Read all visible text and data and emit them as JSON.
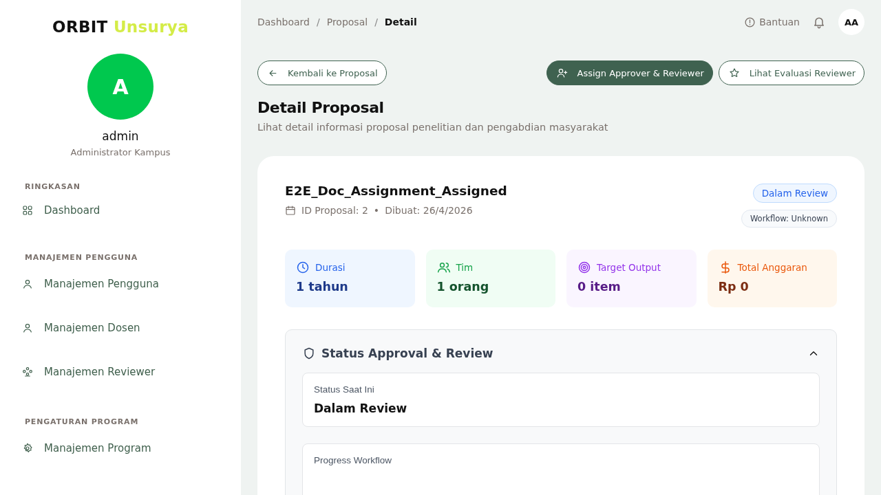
{
  "sidebar": {
    "brand": {
      "name": "ORBIT",
      "accent": "Unsurya"
    },
    "user": {
      "initial": "A",
      "name": "admin",
      "role": "Administrator Kampus"
    },
    "sections": [
      {
        "title": "RINGKASAN",
        "items": [
          {
            "label": "Dashboard",
            "kind": "grid"
          }
        ]
      },
      {
        "title": "MANAJEMEN PENGGUNA",
        "items": [
          {
            "label": "Manajemen Pengguna",
            "kind": "user"
          },
          {
            "label": "Manajemen Dosen",
            "kind": "user"
          },
          {
            "label": "Manajemen Reviewer",
            "kind": "group"
          }
        ]
      },
      {
        "title": "PENGATURAN PROGRAM",
        "items": [
          {
            "label": "Manajemen Program",
            "kind": "gear"
          }
        ]
      }
    ]
  },
  "topbar": {
    "breadcrumbs": [
      {
        "label": "Dashboard",
        "selected": false
      },
      {
        "label": "Proposal",
        "selected": false
      },
      {
        "label": "Detail",
        "selected": true
      }
    ],
    "separator": "/",
    "help": "Bantuan",
    "avatar": "AA"
  },
  "actions": {
    "back": "Kembali ke Proposal",
    "assign": "Assign Approver & Reviewer",
    "evaluation": "Lihat Evaluasi Reviewer"
  },
  "page": {
    "title": "Detail Proposal",
    "subtitle": "Lihat detail informasi proposal penelitian dan pengabdian masyarakat"
  },
  "proposal": {
    "title": "E2E_Doc_Assignment_Assigned",
    "id": "ID Proposal: 2",
    "bullet": "•",
    "created": "Dibuat: 26/4/2026",
    "status": "Dalam Review",
    "workflow": "Workflow: Unknown",
    "stats": [
      {
        "kind": "duration",
        "label": "Durasi",
        "value": "1 tahun"
      },
      {
        "kind": "team",
        "label": "Tim",
        "value": "1 orang"
      },
      {
        "kind": "target",
        "label": "Target Output",
        "value": "0 item"
      },
      {
        "kind": "budget",
        "label": "Total Anggaran",
        "value": "Rp 0"
      }
    ]
  },
  "approval": {
    "title": "Status Approval & Review",
    "expanded": true,
    "current": {
      "label": "Status Saat Ini",
      "value": "Dalam Review"
    },
    "progress": {
      "label": "Progress Workflow"
    }
  }
}
